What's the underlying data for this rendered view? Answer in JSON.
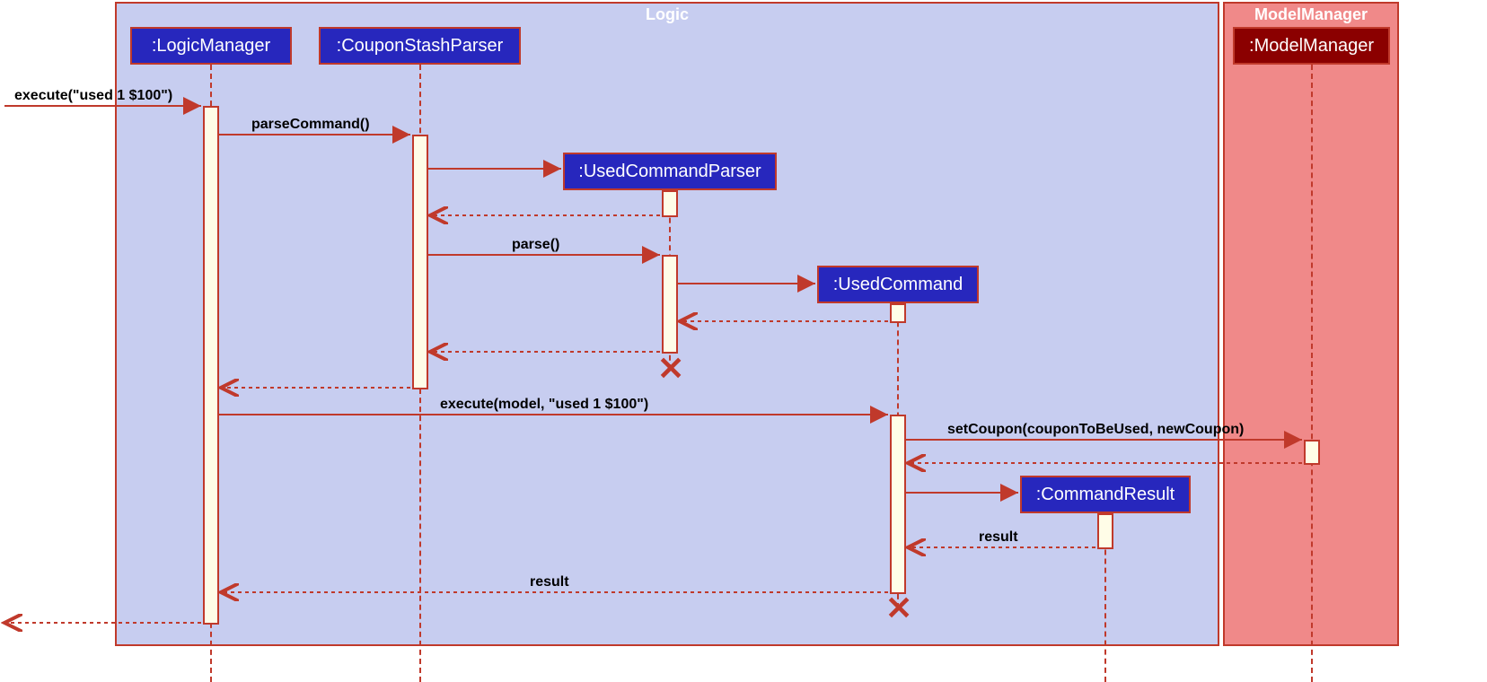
{
  "containers": {
    "logic": {
      "title": "Logic",
      "bg": "#c7cdf0",
      "border": "#c0392b",
      "titleColor": "#ffffff"
    },
    "modelManager": {
      "title": "ModelManager",
      "bg": "#f08989",
      "border": "#c0392b",
      "titleColor": "#ffffff"
    }
  },
  "participants": {
    "logicManager": {
      "label": ":LogicManager",
      "bg": "#2727bd",
      "border": "#c0392b",
      "text": "#ffffff"
    },
    "couponStashParser": {
      "label": ":CouponStashParser",
      "bg": "#2727bd",
      "border": "#c0392b",
      "text": "#ffffff"
    },
    "usedCommandParser": {
      "label": ":UsedCommandParser",
      "bg": "#2727bd",
      "border": "#c0392b",
      "text": "#ffffff"
    },
    "usedCommand": {
      "label": ":UsedCommand",
      "bg": "#2727bd",
      "border": "#c0392b",
      "text": "#ffffff"
    },
    "commandResult": {
      "label": ":CommandResult",
      "bg": "#2727bd",
      "border": "#c0392b",
      "text": "#ffffff"
    },
    "modelManager": {
      "label": ":ModelManager",
      "bg": "#8b0000",
      "border": "#c0392b",
      "text": "#ffffff"
    }
  },
  "messages": {
    "executeUsed": "execute(\"used 1 $100\")",
    "parseCommand": "parseCommand()",
    "parse": "parse()",
    "executeModel": "execute(model, \"used 1 $100\")",
    "setCoupon": "setCoupon(couponToBeUsed, newCoupon)",
    "result1": "result",
    "result2": "result"
  },
  "colors": {
    "arrow": "#c0392b"
  }
}
